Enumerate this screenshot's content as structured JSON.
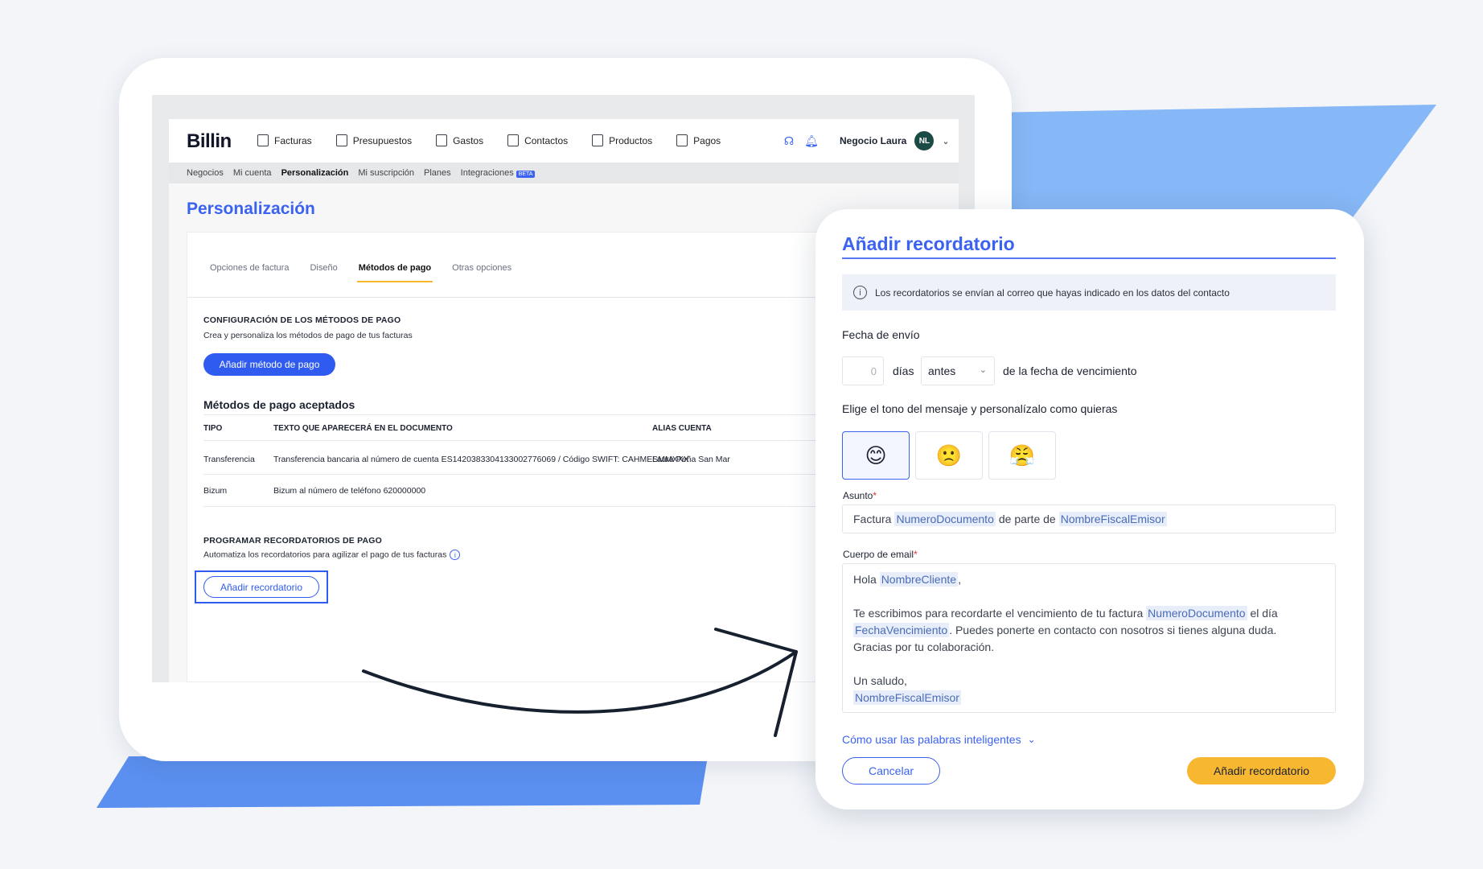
{
  "app": {
    "logo": "Billin",
    "nav": [
      {
        "label": "Facturas",
        "icon": "invoice-icon"
      },
      {
        "label": "Presupuestos",
        "icon": "quote-icon"
      },
      {
        "label": "Gastos",
        "icon": "expense-icon"
      },
      {
        "label": "Contactos",
        "icon": "contact-icon"
      },
      {
        "label": "Productos",
        "icon": "product-icon"
      },
      {
        "label": "Pagos",
        "icon": "payment-icon"
      }
    ],
    "business_name": "Negocio Laura",
    "avatar_initials": "NL",
    "subnav": [
      "Negocios",
      "Mi cuenta",
      "Personalización",
      "Mi suscripción",
      "Planes",
      "Integraciones"
    ],
    "beta_badge": "BETA",
    "page_title": "Personalización",
    "tabs": [
      "Opciones de factura",
      "Diseño",
      "Métodos de pago",
      "Otras opciones"
    ],
    "payment_config": {
      "title": "CONFIGURACIÓN DE LOS MÉTODOS DE PAGO",
      "subtitle": "Crea y personaliza los métodos de pago de tus facturas",
      "add_button": "Añadir método de pago"
    },
    "accepted": {
      "title": "Métodos de pago aceptados",
      "headers": [
        "TIPO",
        "TEXTO QUE APARECERÁ EN EL DOCUMENTO",
        "ALIAS CUENTA"
      ],
      "rows": [
        {
          "tipo": "Transferencia",
          "texto": "Transferencia bancaria al número de cuenta ES1420383304133002776069 / Código SWIFT: CAHMESMMXXX",
          "alias": "Laura Peña San Mar"
        },
        {
          "tipo": "Bizum",
          "texto": "Bizum al número de teléfono 620000000",
          "alias": ""
        }
      ]
    },
    "reminders": {
      "title": "PROGRAMAR RECORDATORIOS DE PAGO",
      "subtitle": "Automatiza los recordatorios para agilizar el pago de tus facturas",
      "add_button": "Añadir recordatorio"
    }
  },
  "modal": {
    "title": "Añadir recordatorio",
    "info": "Los recordatorios se envían al correo que hayas indicado en los datos del contacto",
    "send_date_label": "Fecha de envío",
    "days_value": "0",
    "days_label": "días",
    "when_select": "antes",
    "due_suffix": "de la fecha de vencimiento",
    "tone_label": "Elige el tono del mensaje y personalízalo como quieras",
    "tones": [
      "😊",
      "🙁",
      "😤"
    ],
    "subject_label": "Asunto",
    "subject": {
      "p1": "Factura",
      "t1": "NumeroDocumento",
      "p2": "de parte de",
      "t2": "NombreFiscalEmisor"
    },
    "body_label": "Cuerpo de email",
    "body": {
      "hola": "Hola",
      "cliente": "NombreCliente",
      "comma": ",",
      "l2a": "Te escribimos para recordarte el vencimiento de tu factura",
      "l2tag": "NumeroDocumento",
      "l2b": "el día",
      "l3tag": "FechaVencimiento",
      "l3b": ". Puedes ponerte en contacto con nosotros si tienes alguna duda.",
      "l4": "Gracias por tu colaboración.",
      "l5": "Un saludo,",
      "l6tag": "NombreFiscalEmisor"
    },
    "smart_words_link": "Cómo usar las palabras inteligentes",
    "cancel": "Cancelar",
    "submit": "Añadir recordatorio"
  },
  "colors": {
    "accent": "#3b62f0",
    "submit": "#f7b731",
    "deco": "#7fb2f7"
  }
}
